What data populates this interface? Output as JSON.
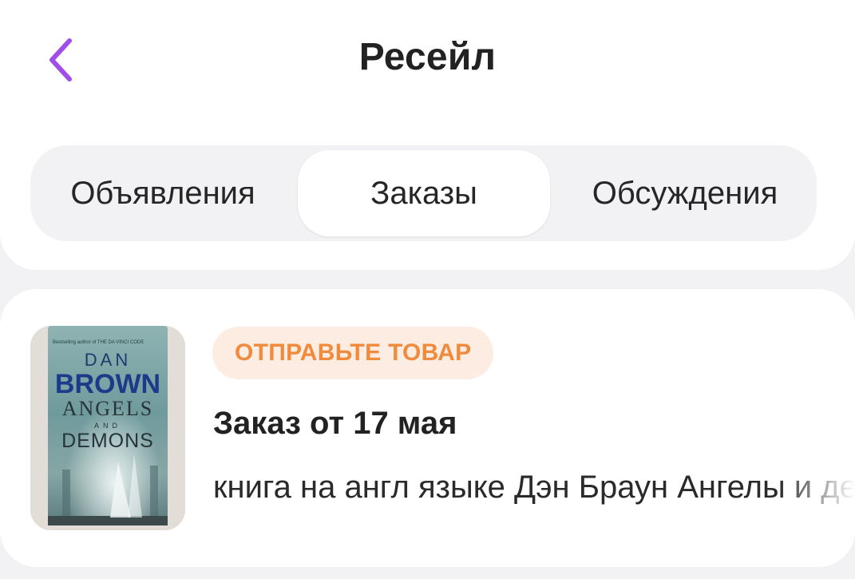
{
  "header": {
    "title": "Ресейл",
    "back_icon": "chevron-left-icon",
    "accent_color": "#a24de9"
  },
  "tabs": [
    {
      "label": "Объявления",
      "active": false
    },
    {
      "label": "Заказы",
      "active": true
    },
    {
      "label": "Обсуждения",
      "active": false
    }
  ],
  "order": {
    "status": "ОТПРАВЬТЕ ТОВАР",
    "status_color": "#f08a3c",
    "status_bg": "#fdece2",
    "title": "Заказ от 17 мая",
    "description": "книга на англ языке Дэн Браун Ангелы и демоны",
    "thumbnail": {
      "bestseller_line": "Bestselling author of THE DA VINCI CODE",
      "author_first": "DAN",
      "author_last": "BROWN",
      "title_line1": "ANGELS",
      "title_and": "AND",
      "title_line2": "DEMONS"
    }
  }
}
